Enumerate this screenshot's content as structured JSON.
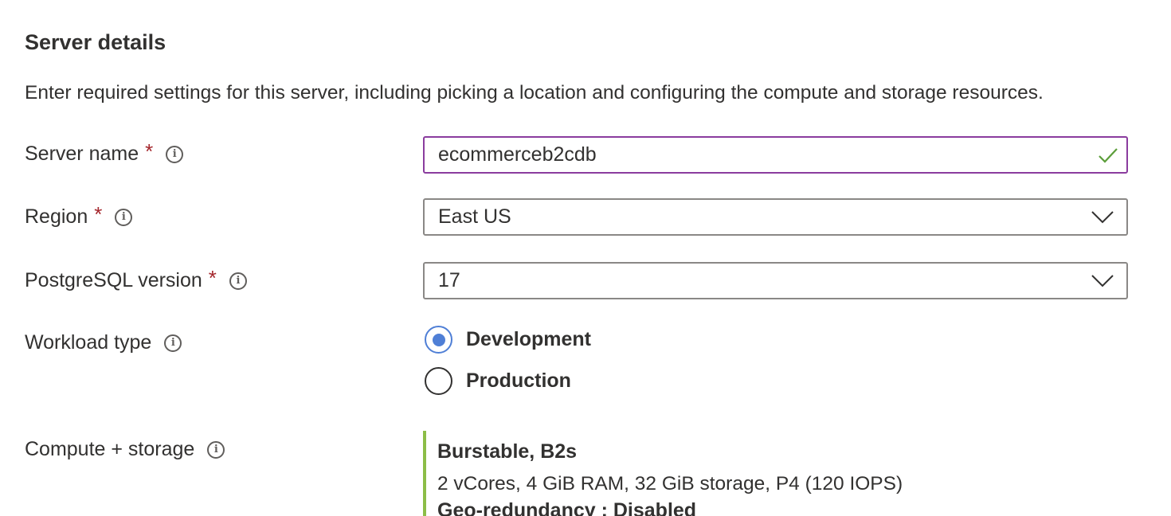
{
  "section": {
    "title": "Server details",
    "description": "Enter required settings for this server, including picking a location and configuring the compute and storage resources."
  },
  "fields": {
    "server_name": {
      "label": "Server name",
      "required_mark": "*",
      "value": "ecommerceb2cdb"
    },
    "region": {
      "label": "Region",
      "required_mark": "*",
      "value": "East US"
    },
    "postgres_version": {
      "label": "PostgreSQL version",
      "required_mark": "*",
      "value": "17"
    },
    "workload_type": {
      "label": "Workload type",
      "options": [
        {
          "label": "Development",
          "selected": true
        },
        {
          "label": "Production",
          "selected": false
        }
      ]
    },
    "compute_storage": {
      "label": "Compute + storage",
      "tier": "Burstable, B2s",
      "details": "2 vCores, 4 GiB RAM, 32 GiB storage, P4 (120 IOPS)",
      "geo_redundancy": "Geo-redundancy : Disabled"
    }
  },
  "icons": {
    "info_glyph": "i"
  },
  "colors": {
    "required": "#a4262c",
    "input_focus_border": "#8a3c9e",
    "valid_check": "#5c9e3a",
    "radio_selected": "#4f7fd6",
    "summary_accent": "#8cbd47"
  }
}
